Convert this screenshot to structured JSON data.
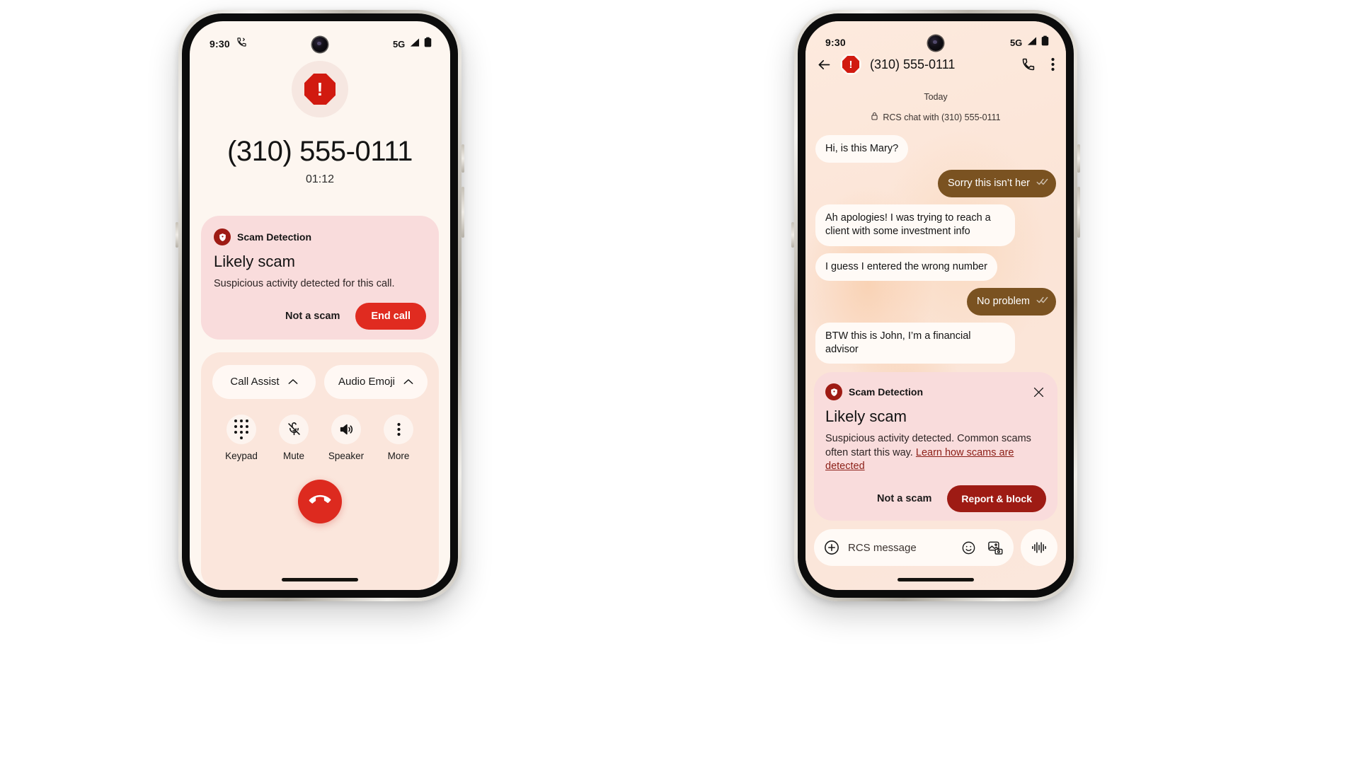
{
  "call_phone": {
    "status_bar": {
      "time": "9:30",
      "left_icon": "phone-forwarded-icon",
      "network": "5G",
      "signal_icon": "signal-bars-icon",
      "battery_icon": "battery-full-icon"
    },
    "avatar_icon": "scam-octagon-icon",
    "number": "(310) 555-0111",
    "duration": "01:12",
    "scam_card": {
      "badge_icon": "shield-alert-icon",
      "header": "Scam Detection",
      "title": "Likely scam",
      "body": "Suspicious activity detected for this call.",
      "secondary_action": "Not a scam",
      "primary_action": "End call"
    },
    "chips": [
      {
        "label": "Call Assist",
        "icon": "chevron-up-icon"
      },
      {
        "label": "Audio Emoji",
        "icon": "chevron-up-icon"
      }
    ],
    "controls": [
      {
        "label": "Keypad",
        "icon": "keypad-icon"
      },
      {
        "label": "Mute",
        "icon": "mic-off-icon"
      },
      {
        "label": "Speaker",
        "icon": "speaker-icon"
      },
      {
        "label": "More",
        "icon": "more-vertical-icon"
      }
    ],
    "end_call_button": {
      "icon": "end-call-icon",
      "label": "End call"
    }
  },
  "messages_phone": {
    "status_bar": {
      "time": "9:30",
      "network": "5G",
      "signal_icon": "signal-bars-icon",
      "battery_icon": "battery-full-icon"
    },
    "app_bar": {
      "back_icon": "back-arrow-icon",
      "contact_badge_icon": "scam-octagon-icon",
      "title": "(310) 555-0111",
      "call_icon": "phone-icon",
      "menu_icon": "more-vertical-icon"
    },
    "thread": {
      "day_label": "Today",
      "encryption_icon": "lock-icon",
      "encryption_label": "RCS chat with (310) 555-0111",
      "messages": [
        {
          "dir": "in",
          "text": "Hi, is this Mary?"
        },
        {
          "dir": "out",
          "text": "Sorry this isn’t her",
          "status_icon": "double-check-icon"
        },
        {
          "dir": "in",
          "text": "Ah apologies! I was trying to reach a client with some investment info"
        },
        {
          "dir": "in",
          "text": "I guess I entered the wrong number"
        },
        {
          "dir": "out",
          "text": "No problem",
          "status_icon": "double-check-icon"
        },
        {
          "dir": "in",
          "text": "BTW this is John, I’m a financial advisor"
        }
      ]
    },
    "scam_card": {
      "badge_icon": "shield-alert-icon",
      "header": "Scam Detection",
      "close_icon": "close-icon",
      "title": "Likely scam",
      "body": "Suspicious activity detected. Common scams often start this way. ",
      "link": "Learn how scams are detected",
      "secondary_action": "Not a scam",
      "primary_action": "Report & block"
    },
    "composer": {
      "add_icon": "plus-circle-icon",
      "placeholder": "RCS message",
      "emoji_icon": "emoji-icon",
      "gallery_icon": "image-icon",
      "mic_icon": "voice-waveform-icon"
    }
  },
  "colors": {
    "scam_red": "#d11a10",
    "dark_red": "#9e1b14",
    "end_call_red": "#dd2a1f",
    "card_pink": "#f9dcdc",
    "call_bg": "#fdf6f0",
    "msg_bg": "#fbe6da",
    "out_bubble": "#7a5221",
    "in_bubble": "#fffaf6"
  }
}
